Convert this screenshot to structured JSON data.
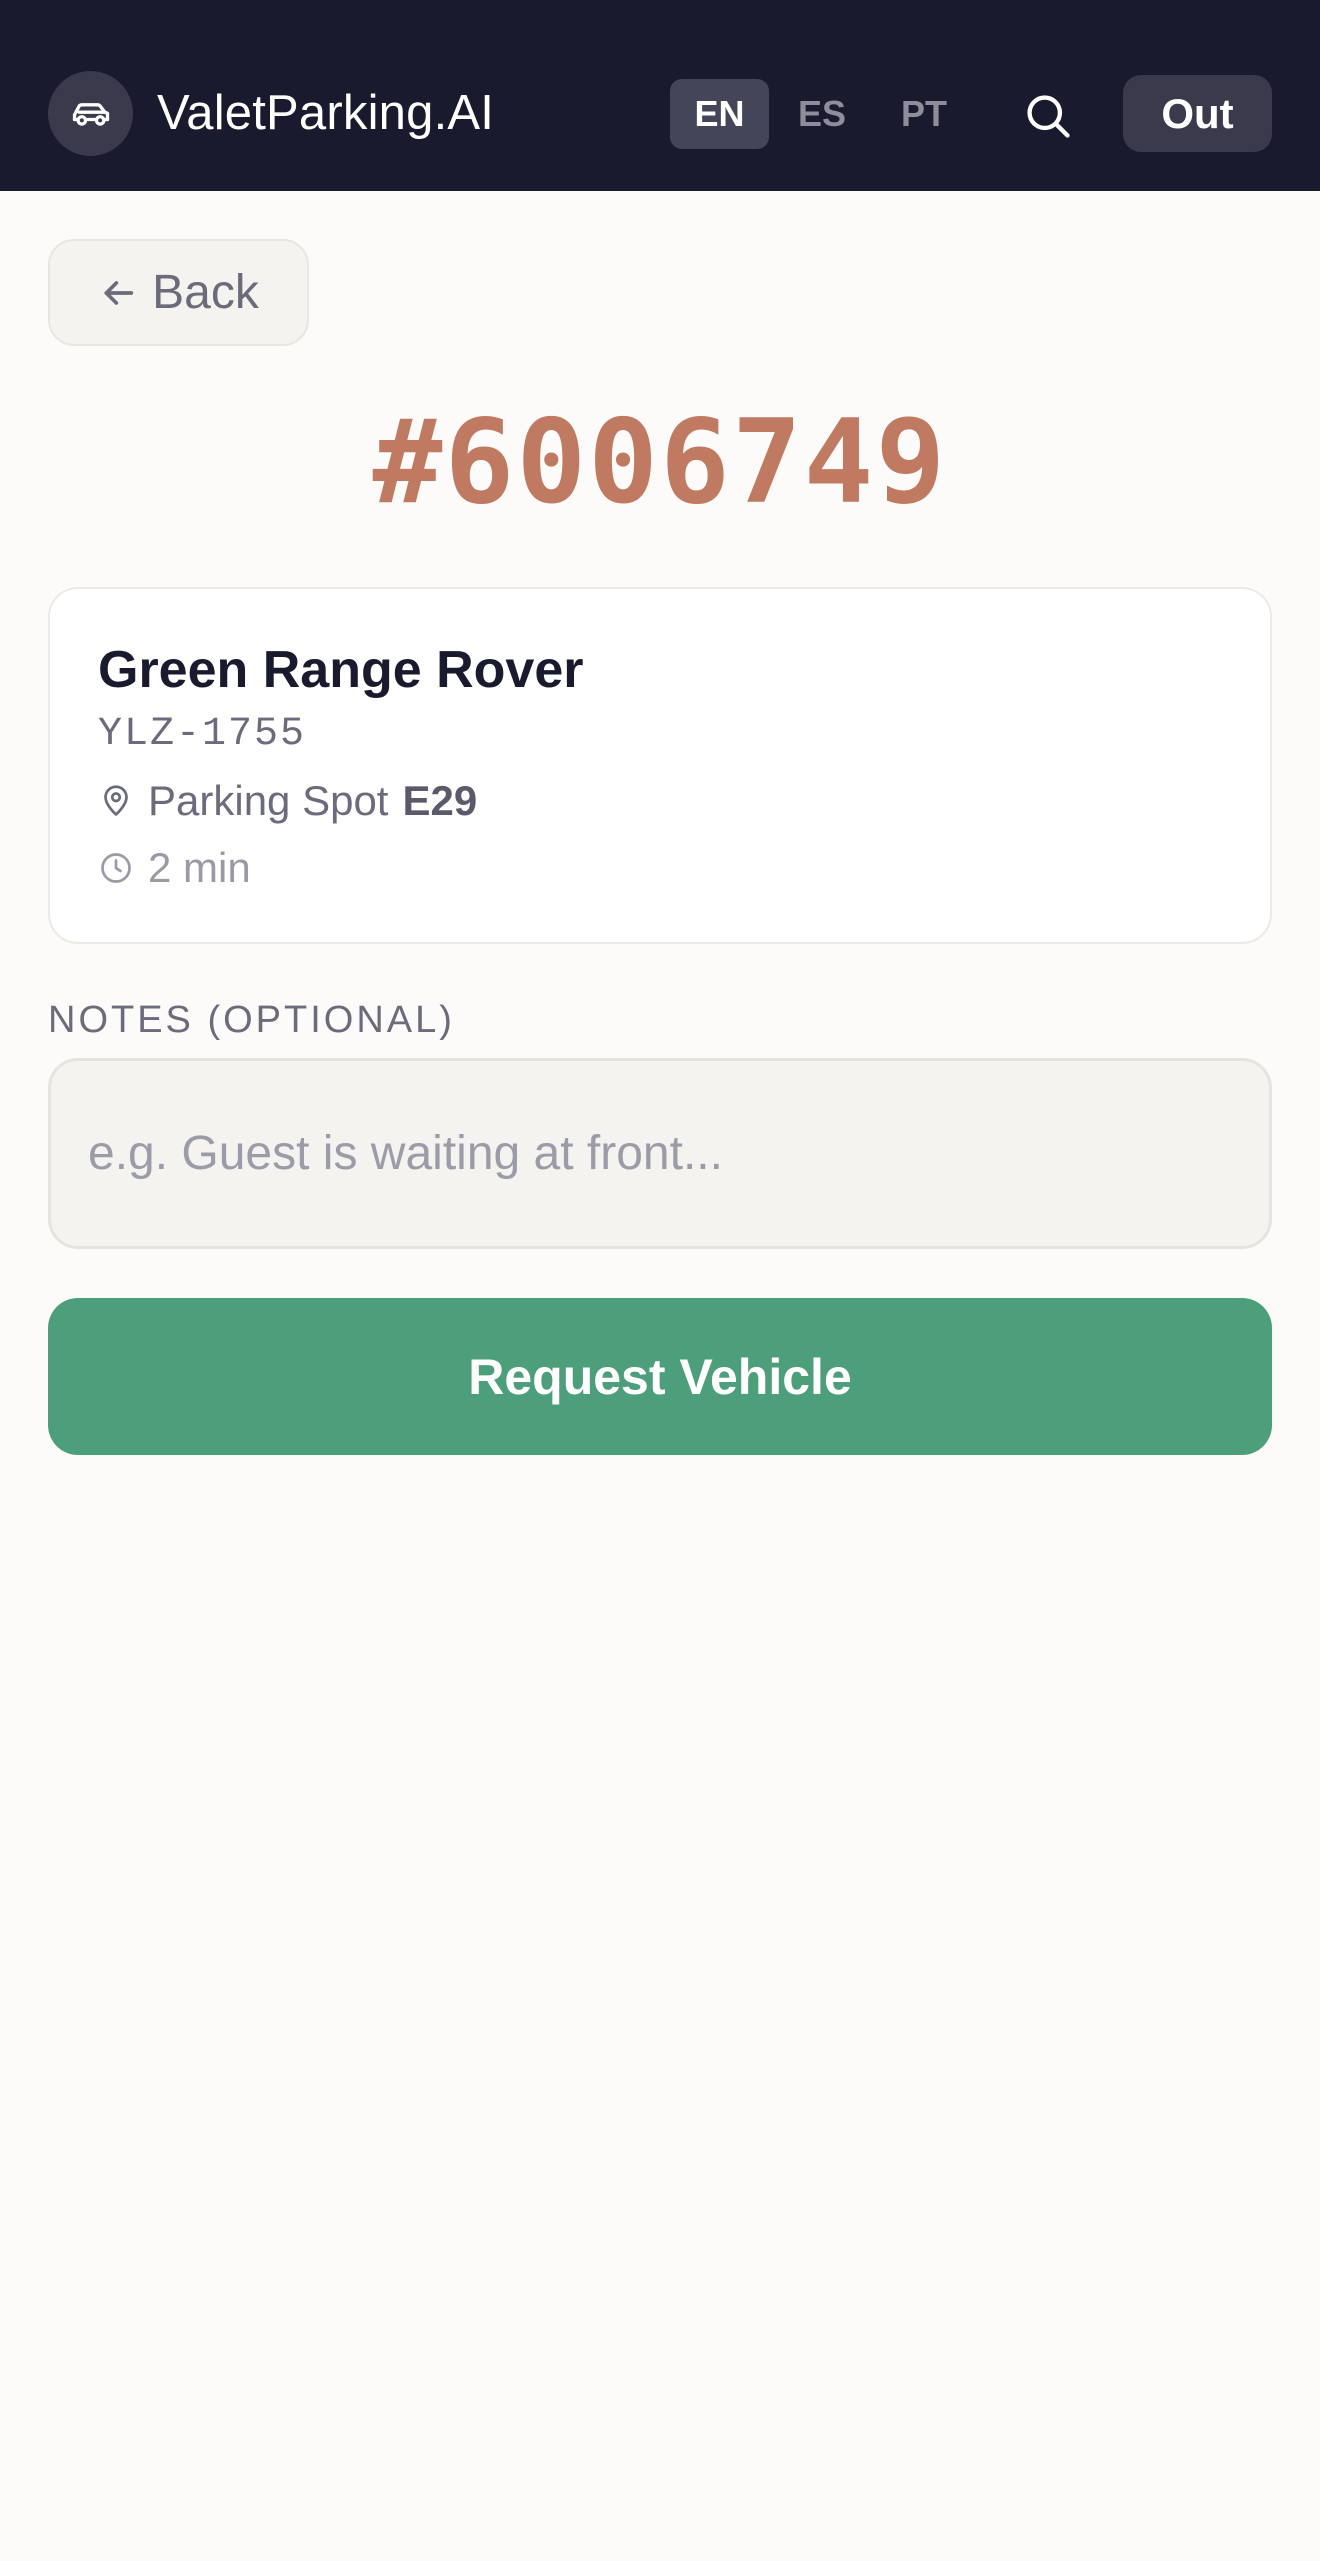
{
  "header": {
    "brand": "ValetParking.AI",
    "logo_icon": "car-icon",
    "languages": [
      {
        "label": "EN",
        "active": true
      },
      {
        "label": "ES",
        "active": false
      },
      {
        "label": "PT",
        "active": false
      }
    ],
    "search_icon": "search-icon",
    "logout_label": "Out"
  },
  "back": {
    "label": "Back",
    "icon": "arrow-left-icon"
  },
  "ticket": {
    "number": "#6006749"
  },
  "vehicle": {
    "name": "Green Range Rover",
    "plate": "YLZ-1755",
    "spot_prefix": "Parking Spot",
    "spot": "E29",
    "spot_icon": "map-pin-icon",
    "time": "2 min",
    "time_icon": "clock-icon"
  },
  "notes": {
    "label": "NOTES (OPTIONAL)",
    "placeholder": "e.g. Guest is waiting at front...",
    "value": ""
  },
  "request": {
    "label": "Request Vehicle"
  },
  "colors": {
    "header_bg": "#1a1a2e",
    "page_bg": "#fcfbf9",
    "ticket": "#c07a62",
    "primary": "#4d9e7a"
  }
}
